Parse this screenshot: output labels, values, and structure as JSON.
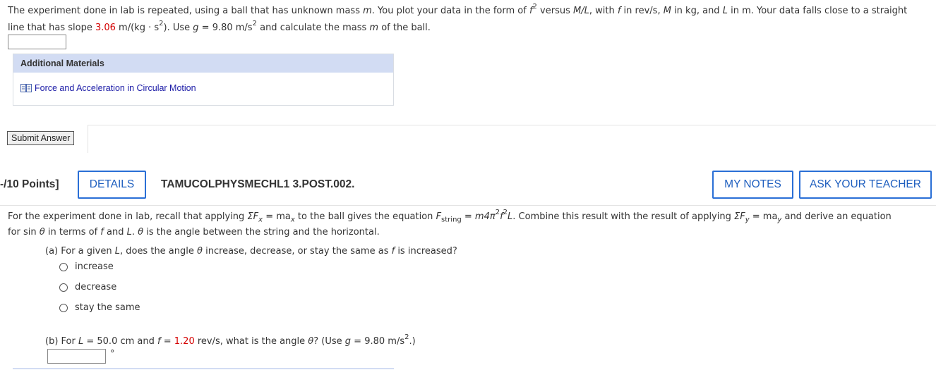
{
  "question1": {
    "line1": "The experiment done in lab is repeated, using a ball that has unknown mass ",
    "m": "m",
    "line1b": ". You plot your data in the form of ",
    "f": "f",
    "sq": "2",
    "versus": " versus ",
    "ML": "M/L",
    "with": ", with ",
    "f2": "f",
    "inrev": " in rev/s, ",
    "M": "M",
    "inkg": " in kg, and ",
    "L": "L",
    "inm": " in m. Your data falls close to a straight",
    "line2a": "line that has slope ",
    "slope": "3.06",
    "unit": " m/(kg · s",
    "unitsq": "2",
    "unitend": "). Use ",
    "g": "g",
    "gval": " = 9.80 m/s",
    "gsq": "2",
    "line2b": " and calculate the mass ",
    "m2": "m",
    "line2c": " of the ball."
  },
  "additional_materials": {
    "header": "Additional Materials",
    "link_label": "Force and Acceleration in Circular Motion",
    "link_icon": "book-icon"
  },
  "submit": {
    "label": "Submit Answer"
  },
  "question2": {
    "points": "-/10 Points]",
    "details_label": "DETAILS",
    "code": "TAMUCOLPHYSMECHL1 3.POST.002.",
    "my_notes_label": "MY NOTES",
    "ask_teacher_label": "ASK YOUR TEACHER",
    "p1": "For the experiment done in lab, recall that applying ",
    "sigma_fx": "ΣF",
    "x": "x",
    "eq1": " = ma",
    "x2": "x",
    "p1b": " to the ball gives the equation ",
    "F": "F",
    "string": "string",
    "eq2": " = m4π",
    "pisq": "2",
    "f": "f",
    "fsq": "2",
    "Lterm": "L",
    "p1c": ". Combine this result with the result of applying ",
    "sigma_fy": "ΣF",
    "y": "y",
    "eq3": " = ma",
    "y2": "y",
    "p1d": " and derive an equation",
    "p2a": "for sin ",
    "theta": "θ",
    "p2b": " in terms of ",
    "f3": "f",
    "p2c": " and ",
    "L2": "L",
    "p2d": ". ",
    "theta2": "θ",
    "p2e": " is the angle between the string and the horizontal.",
    "part_a": "(a) For a given ",
    "part_a_L": "L",
    "part_a2": ", does the angle ",
    "part_a_theta": "θ",
    "part_a3": " increase, decrease, or stay the same as ",
    "part_a_f": "f",
    "part_a4": " is increased?",
    "options": [
      "increase",
      "decrease",
      "stay the same"
    ],
    "part_b": "(b) For  ",
    "part_b_L": "L",
    "part_b2": " = 50.0 cm  and  ",
    "part_b_f": "f",
    "part_b3": " = ",
    "part_b_fval": "1.20",
    "part_b4": " rev/s,  what is the angle ",
    "part_b_theta": "θ",
    "part_b5": "? (Use  ",
    "part_b_g": "g",
    "part_b6": " = 9.80 m/s",
    "part_b_gsq": "2",
    "part_b7": ".)",
    "degree_symbol": "°"
  },
  "colors": {
    "accent_blue": "#2a6fd6",
    "highlight_red": "#d40000",
    "header_bg": "#d2dcf3"
  }
}
